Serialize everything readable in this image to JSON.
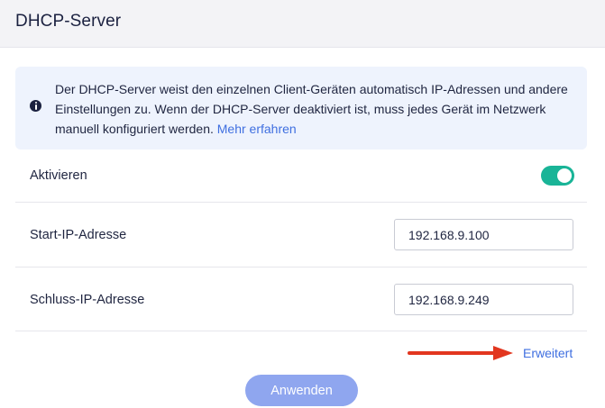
{
  "header": {
    "title": "DHCP-Server"
  },
  "info": {
    "icon": "info-icon",
    "text": "Der DHCP-Server weist den einzelnen Client-Geräten automatisch IP-Adressen und andere Einstellungen zu. Wenn der DHCP-Server deaktiviert ist, muss jedes Gerät im Netzwerk manuell konfiguriert werden.",
    "link_label": "Mehr erfahren"
  },
  "settings": {
    "activate": {
      "label": "Aktivieren",
      "enabled": true,
      "toggle_color": "#19b497"
    },
    "start_ip": {
      "label": "Start-IP-Adresse",
      "value": "192.168.9.100"
    },
    "end_ip": {
      "label": "Schluss-IP-Adresse",
      "value": "192.168.9.249"
    }
  },
  "advanced": {
    "label": "Erweitert",
    "annotation_arrow_color": "#e2361f"
  },
  "actions": {
    "apply_label": "Anwenden",
    "apply_color": "#8fa6ef"
  },
  "colors": {
    "link": "#3f6fe0",
    "info_bg": "#eef3fd",
    "header_bg": "#f3f3f6"
  }
}
